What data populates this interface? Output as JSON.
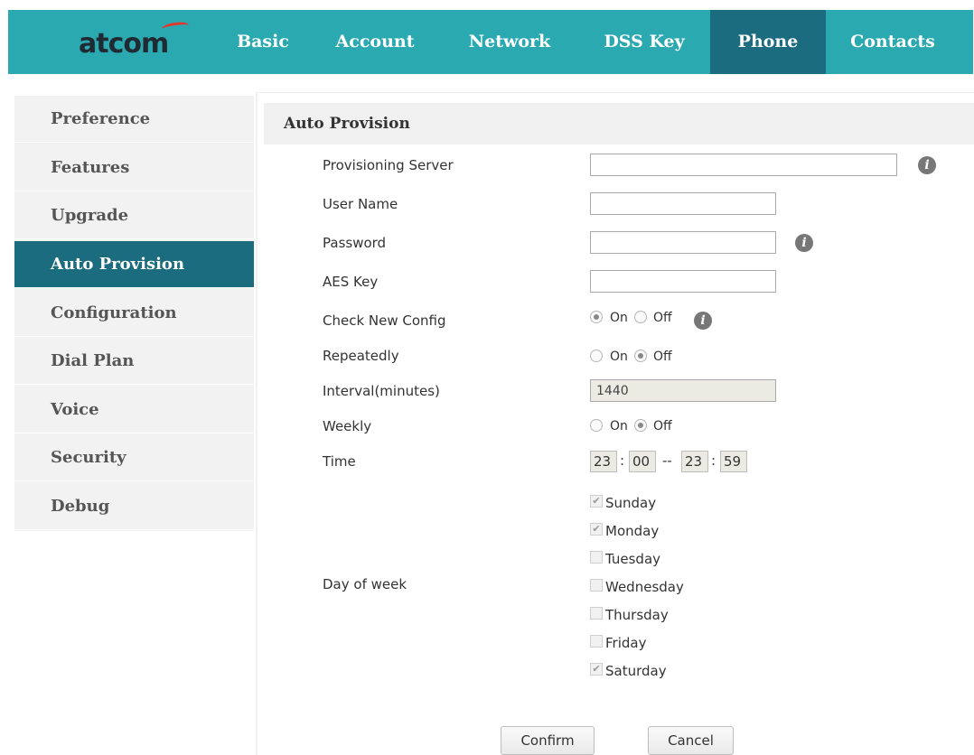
{
  "brand": {
    "logo_text": "atcom",
    "colors": {
      "header": "#2ba9b0",
      "active": "#1a6c7e",
      "logo_swoosh": "#e5342a"
    }
  },
  "nav": {
    "tabs": [
      {
        "label": "Basic",
        "active": false
      },
      {
        "label": "Account",
        "active": false
      },
      {
        "label": "Network",
        "active": false
      },
      {
        "label": "DSS Key",
        "active": false
      },
      {
        "label": "Phone",
        "active": true
      },
      {
        "label": "Contacts",
        "active": false
      }
    ]
  },
  "sidebar": {
    "items": [
      {
        "label": "Preference",
        "active": false
      },
      {
        "label": "Features",
        "active": false
      },
      {
        "label": "Upgrade",
        "active": false
      },
      {
        "label": "Auto Provision",
        "active": true
      },
      {
        "label": "Configuration",
        "active": false
      },
      {
        "label": "Dial Plan",
        "active": false
      },
      {
        "label": "Voice",
        "active": false
      },
      {
        "label": "Security",
        "active": false
      },
      {
        "label": "Debug",
        "active": false
      }
    ]
  },
  "form": {
    "title": "Auto Provision",
    "provisioning_server": {
      "label": "Provisioning Server",
      "value": ""
    },
    "user_name": {
      "label": "User Name",
      "value": ""
    },
    "password": {
      "label": "Password",
      "value": ""
    },
    "aes_key": {
      "label": "AES Key",
      "value": ""
    },
    "check_new_config": {
      "label": "Check New Config",
      "on": "On",
      "off": "Off",
      "selected": "On"
    },
    "repeatedly": {
      "label": "Repeatedly",
      "on": "On",
      "off": "Off",
      "selected": "Off"
    },
    "interval": {
      "label": "Interval(minutes)",
      "value": "1440"
    },
    "weekly": {
      "label": "Weekly",
      "on": "On",
      "off": "Off",
      "selected": "Off"
    },
    "time": {
      "label": "Time",
      "start_hour": "23",
      "start_min": "00",
      "end_hour": "23",
      "end_min": "59",
      "colon": ":",
      "range_sep": "--"
    },
    "day_of_week": {
      "label": "Day of week",
      "days": [
        {
          "label": "Sunday",
          "checked": true
        },
        {
          "label": "Monday",
          "checked": true
        },
        {
          "label": "Tuesday",
          "checked": false
        },
        {
          "label": "Wednesday",
          "checked": false
        },
        {
          "label": "Thursday",
          "checked": false
        },
        {
          "label": "Friday",
          "checked": false
        },
        {
          "label": "Saturday",
          "checked": true
        }
      ]
    },
    "info_glyph": "i",
    "check_glyph": "✔",
    "confirm_label": "Confirm",
    "cancel_label": "Cancel"
  }
}
